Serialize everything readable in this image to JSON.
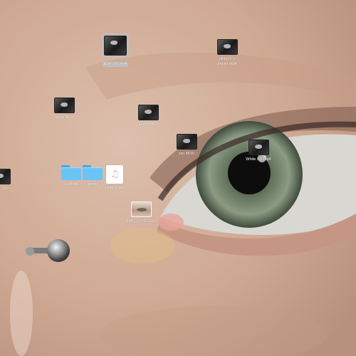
{
  "desktop": {
    "icons": [
      {
        "id": "vojti",
        "label": "вoйт 0.5.mp4",
        "kind": "video",
        "selected": true
      },
      {
        "id": "white_pravki",
        "label": "white 0.5 pravki.mp4",
        "kind": "video"
      },
      {
        "id": "sepce",
        "label": "сepce.MOV",
        "kind": "video"
      },
      {
        "id": "ne_eho",
        "label": "не эхо.MOV",
        "kind": "video"
      },
      {
        "id": "eho",
        "label": "эхо.MOV",
        "kind": "video"
      },
      {
        "id": "white05",
        "label": "White 0.5.mp4",
        "kind": "video"
      },
      {
        "id": "partial",
        "label": "OV",
        "kind": "video"
      },
      {
        "id": "klipa",
        "label": "КЛИПА",
        "kind": "folder"
      },
      {
        "id": "klepi",
        "label": "клепи",
        "kind": "folder"
      },
      {
        "id": "white2",
        "label": "white 2.wav",
        "kind": "audio"
      },
      {
        "id": "img",
        "label": "IMG_0772.CR2",
        "kind": "photo"
      }
    ]
  },
  "icon_names": {
    "video": "video-file-icon",
    "folder": "folder-icon",
    "audio": "audio-file-icon",
    "photo": "photo-file-icon"
  },
  "colors": {
    "folder": "#6cc4f4",
    "selection": "#bfbfbf"
  }
}
